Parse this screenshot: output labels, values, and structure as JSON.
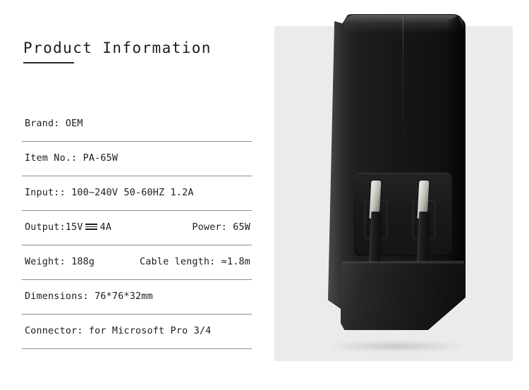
{
  "page": {
    "background_color": "#ffffff"
  },
  "info": {
    "title": "Product Information",
    "specs": [
      {
        "label": "Brand: OEM",
        "aux": ""
      },
      {
        "label": "Item No.: PA-65W",
        "aux": ""
      },
      {
        "label": "Input:: 100~240V 50-60HZ 1.2A",
        "aux": ""
      },
      {
        "label_before_dc": "Output:15V",
        "label_after_dc": "4A",
        "has_dc_symbol": true,
        "aux": "Power: 65W"
      },
      {
        "label": "Weight: 188g",
        "aux": "Cable length: ≈1.8m"
      },
      {
        "label": "Dimensions: 76*76*32mm",
        "aux": ""
      },
      {
        "label": "Connector: for Microsoft Pro 3/4",
        "aux": ""
      }
    ]
  },
  "photo": {
    "panel_background_color": "#ebebeb",
    "product_name": "black-power-adapter-with-folding-prongs",
    "body_color": "#16161a",
    "prong_metal_color": "#d9d7d2"
  }
}
